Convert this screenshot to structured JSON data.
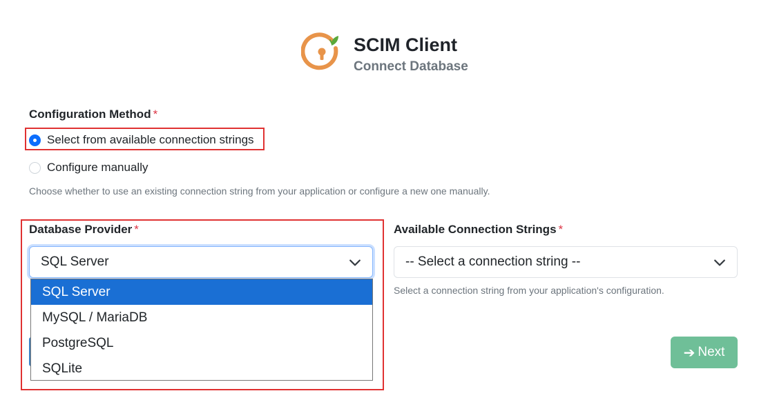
{
  "header": {
    "title": "SCIM Client",
    "subtitle": "Connect Database",
    "logo_icon": "keyhole-logo-icon",
    "logo_color": "#e8944a",
    "leaf_color": "#5aa83a"
  },
  "config_method": {
    "label": "Configuration Method",
    "required_mark": "*",
    "options": [
      {
        "label": "Select from available connection strings",
        "checked": true
      },
      {
        "label": "Configure manually",
        "checked": false
      }
    ],
    "help": "Choose whether to use an existing connection string from your application or configure a new one manually."
  },
  "provider": {
    "label": "Database Provider",
    "required_mark": "*",
    "value": "SQL Server",
    "options": [
      "SQL Server",
      "MySQL / MariaDB",
      "PostgreSQL",
      "SQLite"
    ],
    "selected_index": 0
  },
  "connection_strings": {
    "label": "Available Connection Strings",
    "required_mark": "*",
    "value": "-- Select a connection string --",
    "help": "Select a connection string from your application's configuration."
  },
  "actions": {
    "next_label": "Next",
    "next_icon": "arrow-right-icon",
    "next_color": "#6fbf98"
  },
  "colors": {
    "highlight": "#e03131",
    "accent": "#0d6efd",
    "dropdown_selected": "#1a6fd4"
  }
}
